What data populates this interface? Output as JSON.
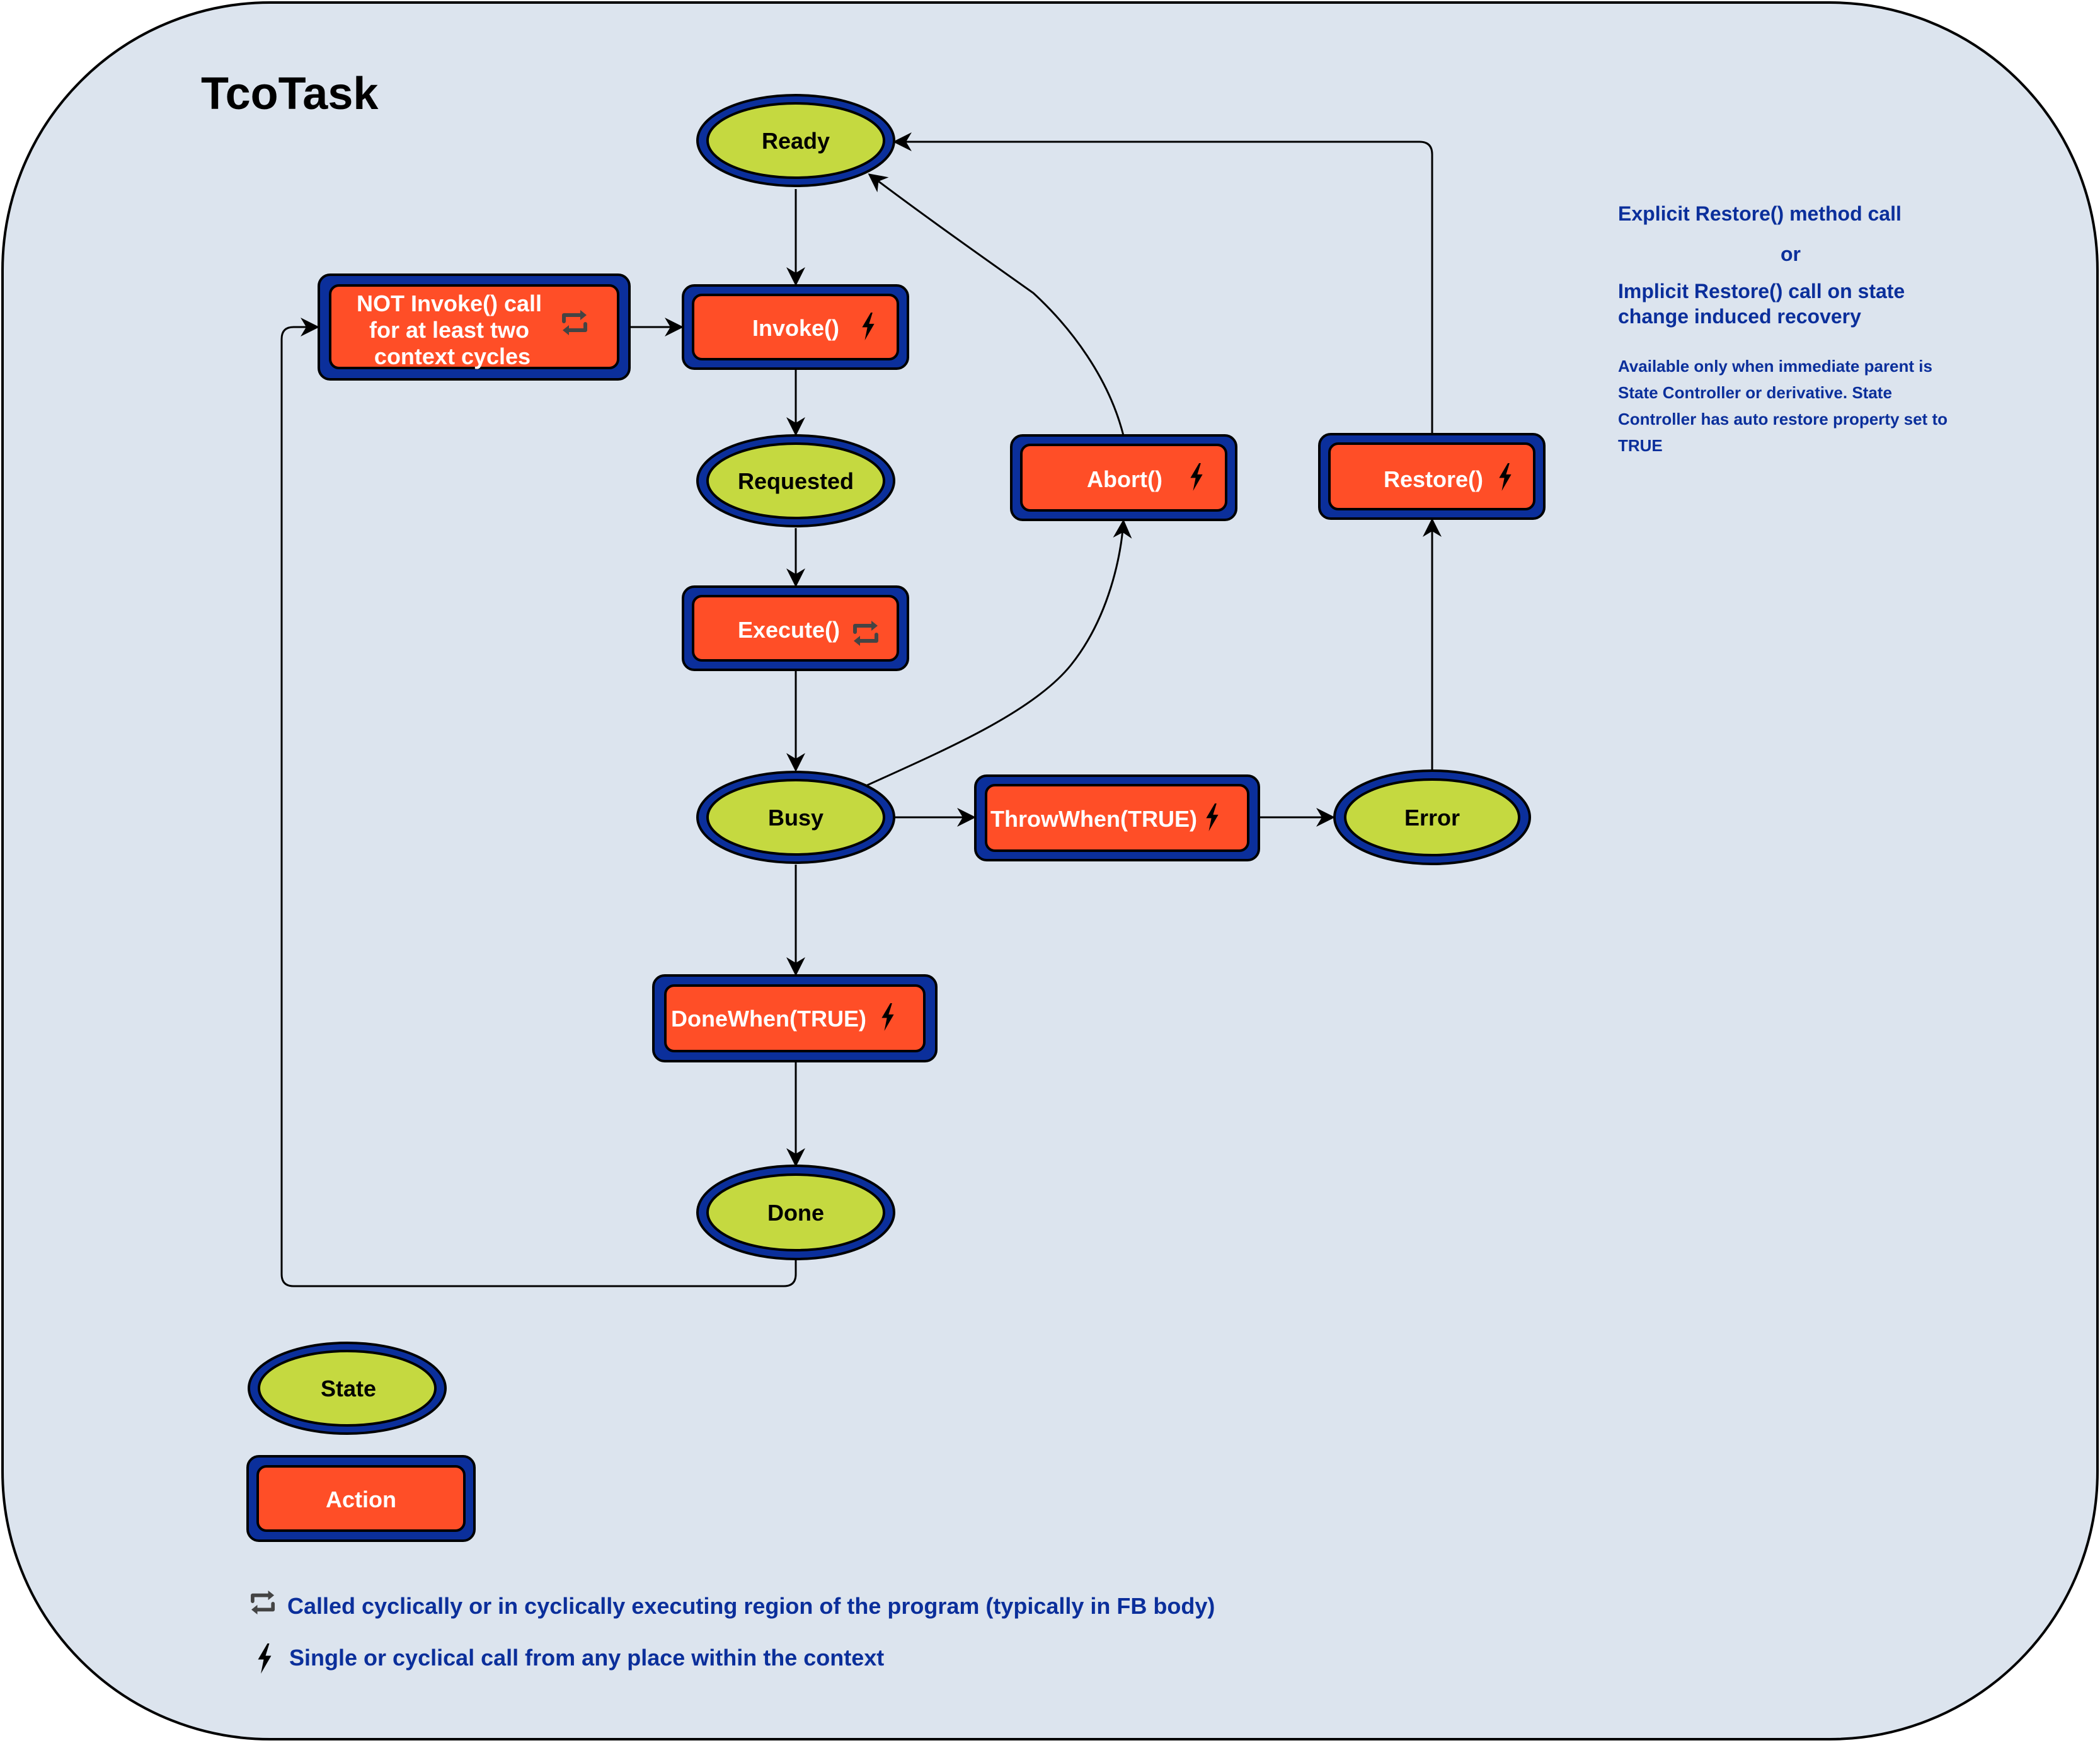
{
  "title": "TcoTask",
  "colors": {
    "background": "#dce4ee",
    "state_fill": "#c5d940",
    "node_border": "#0b2f9b",
    "action_fill": "#ff4e27",
    "note_text": "#0b2f9b"
  },
  "states": {
    "ready": "Ready",
    "requested": "Requested",
    "busy": "Busy",
    "error": "Error",
    "done": "Done"
  },
  "actions": {
    "not_invoke": {
      "lines": [
        "NOT Invoke() call",
        "for at least two",
        "context cycles"
      ],
      "icon": "cycle-icon"
    },
    "invoke": {
      "label": "Invoke()",
      "icon": "lightning-icon"
    },
    "execute": {
      "label": "Execute()",
      "icon": "cycle-icon"
    },
    "abort": {
      "label": "Abort()",
      "icon": "lightning-icon"
    },
    "restore": {
      "label": "Restore()",
      "icon": "lightning-icon"
    },
    "throw_when": {
      "label": "ThrowWhen(TRUE)",
      "icon": "lightning-icon"
    },
    "done_when": {
      "label": "DoneWhen(TRUE)",
      "icon": "lightning-icon"
    }
  },
  "transitions": [
    {
      "from": "Ready",
      "to": "Invoke()"
    },
    {
      "from": "Invoke()",
      "to": "Requested"
    },
    {
      "from": "Requested",
      "to": "Execute()"
    },
    {
      "from": "Execute()",
      "to": "Busy"
    },
    {
      "from": "Busy",
      "to": "DoneWhen(TRUE)"
    },
    {
      "from": "DoneWhen(TRUE)",
      "to": "Done"
    },
    {
      "from": "Done",
      "to": "NOT Invoke() call for at least two context cycles"
    },
    {
      "from": "NOT Invoke() call for at least two context cycles",
      "to": "Invoke()"
    },
    {
      "from": "Busy",
      "to": "Abort()"
    },
    {
      "from": "Abort()",
      "to": "Ready"
    },
    {
      "from": "Busy",
      "to": "ThrowWhen(TRUE)"
    },
    {
      "from": "ThrowWhen(TRUE)",
      "to": "Error"
    },
    {
      "from": "Error",
      "to": "Restore()"
    },
    {
      "from": "Restore()",
      "to": "Ready"
    }
  ],
  "notes": {
    "explicit": "Explicit Restore() method call",
    "or": "or",
    "implicit_lines": [
      "Implicit Restore() call on state",
      "change induced recovery"
    ],
    "availability_lines": [
      "Available only when immediate parent is",
      "State Controller or derivative. State",
      "Controller has auto restore property set to",
      "TRUE"
    ]
  },
  "legend": {
    "state_label": "State",
    "action_label": "Action",
    "cyclic_text": "Called cyclically or in cyclically executing region of the program (typically in FB body)",
    "single_text": "Single or cyclical call from any place within the context"
  }
}
